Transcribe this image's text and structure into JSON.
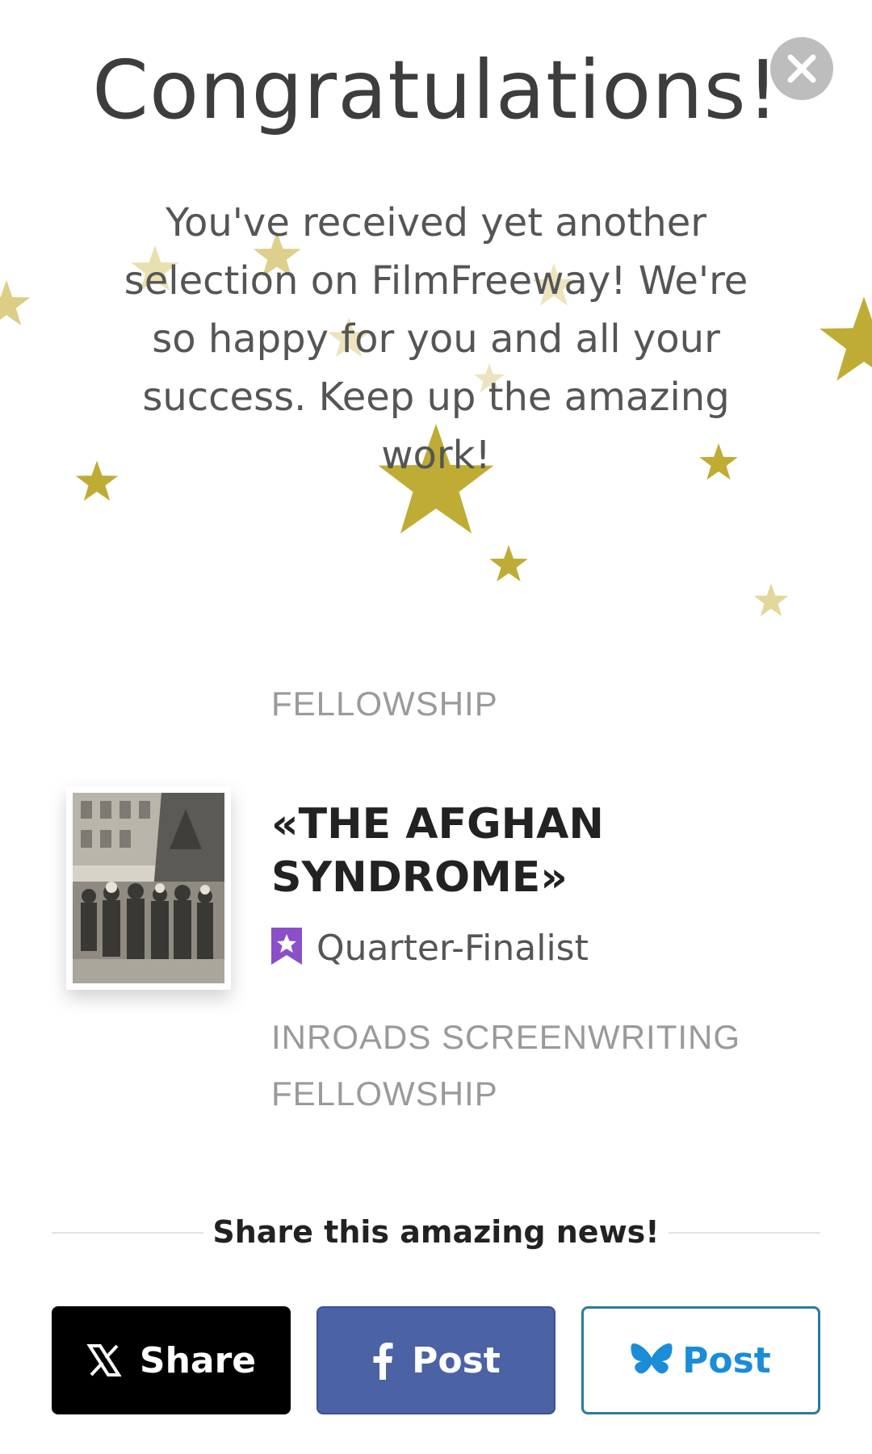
{
  "dialog": {
    "title": "Congratulations!",
    "message": "You've received yet another selection on FilmFreeway! We're so happy for you and all your success. Keep up the amazing work!",
    "close_icon": "close-icon"
  },
  "selection": {
    "category": "FELLOWSHIP",
    "project_title": "«THE AFGHAN SYNDROME»",
    "award_icon": "bookmark-star-icon",
    "award": "Quarter-Finalist",
    "festival": "INROADS SCREENWRITING FELLOWSHIP"
  },
  "share": {
    "heading": "Share this amazing news!",
    "buttons": [
      {
        "label": "Share",
        "icon": "x-logo-icon"
      },
      {
        "label": "Post",
        "icon": "facebook-icon"
      },
      {
        "label": "Post",
        "icon": "bluesky-icon"
      }
    ]
  },
  "colors": {
    "star_gold": "#bfac35",
    "award_purple": "#8b4fc7",
    "facebook_blue": "#4b62a4",
    "bluesky_blue": "#1a8cd8"
  }
}
